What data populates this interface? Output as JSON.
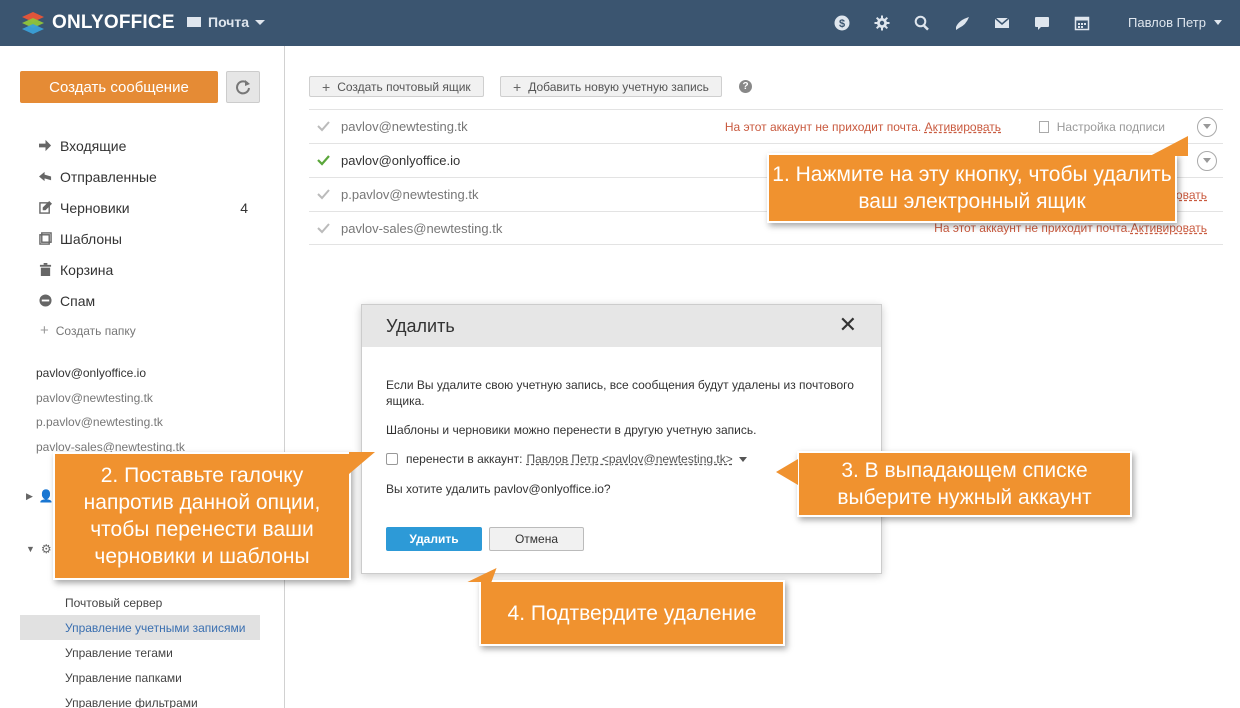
{
  "topbar": {
    "logo_text": "ONLYOFFICE",
    "module": "Почта",
    "user": "Павлов Петр",
    "icons": [
      "dollar-icon",
      "gear-icon",
      "search-icon",
      "feed-icon",
      "mail-icon",
      "chat-icon",
      "calendar-icon"
    ]
  },
  "sidebar": {
    "create_label": "Создать сообщение",
    "nav": [
      {
        "label": "Входящие",
        "icon": "arrow-right-icon"
      },
      {
        "label": "Отправленные",
        "icon": "reply-icon"
      },
      {
        "label": "Черновики",
        "icon": "edit-icon",
        "count": "4"
      },
      {
        "label": "Шаблоны",
        "icon": "copy-icon"
      },
      {
        "label": "Корзина",
        "icon": "trash-icon"
      },
      {
        "label": "Спам",
        "icon": "spam-icon"
      }
    ],
    "create_folder": "Создать папку",
    "accounts": [
      "pavlov@onlyoffice.io",
      "pavlov@newtesting.tk",
      "p.pavlov@newtesting.tk",
      "pavlov-sales@newtesting.tk"
    ],
    "settings": [
      "Почтовый сервер",
      "Управление учетными записями",
      "Управление тегами",
      "Управление папками",
      "Управление фильтрами"
    ]
  },
  "main": {
    "btn_create_box": "Создать почтовый ящик",
    "btn_add_account": "Добавить новую учетную запись",
    "rows": [
      {
        "email": "pavlov@newtesting.tk",
        "warn": "На этот аккаунт не приходит почта.",
        "activate": "Активировать",
        "signature": "Настройка подписи"
      },
      {
        "email": "pavlov@onlyoffice.io",
        "warn": "",
        "activate": "",
        "signature": ""
      },
      {
        "email": "p.pavlov@newtesting.tk",
        "warn": "",
        "activate": "ровать",
        "signature": ""
      },
      {
        "email": "pavlov-sales@newtesting.tk",
        "warn": "На этот аккаунт не приходит почта.",
        "activate": "Активировать",
        "signature": ""
      }
    ]
  },
  "dialog": {
    "title": "Удалить",
    "p1": "Если Вы удалите свою учетную запись, все сообщения будут удалены из почтового ящика.",
    "p2": "Шаблоны и черновики можно перенести в другую учетную запись.",
    "move_label": "перенести в аккаунт:",
    "move_value": "Павлов Петр <pavlov@newtesting.tk>",
    "question": "Вы хотите удалить pavlov@onlyoffice.io?",
    "delete_label": "Удалить",
    "cancel_label": "Отмена"
  },
  "callouts": {
    "c1": "1. Нажмите на эту кнопку, чтобы удалить ваш электронный ящик",
    "c2": "2. Поставьте галочку напротив данной опции, чтобы перенести ваши черновики и шаблоны",
    "c3": "3. В выпадающем списке выберите нужный аккаунт",
    "c4": "4. Подтвердите удаление"
  },
  "colors": {
    "topbar": "#3b5570",
    "accent": "#e58b35",
    "callout": "#f0922f",
    "primary": "#2d9ad7",
    "warn": "#c95a3f"
  }
}
